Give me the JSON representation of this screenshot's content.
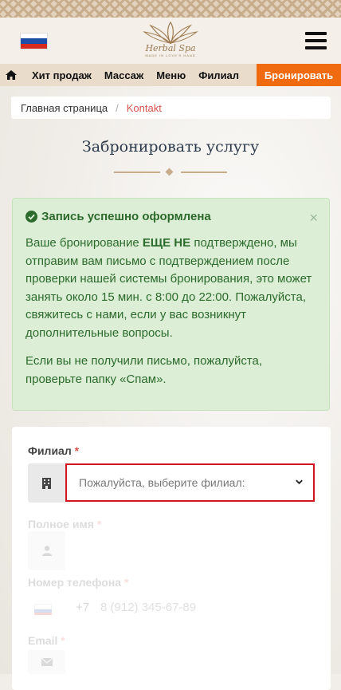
{
  "header": {
    "logo_text": "Herbal Spa",
    "logo_subtitle": "MADE IN LOVE'S HAND",
    "flag_colors": [
      "#ffffff",
      "#1f4ea8",
      "#d52b1e"
    ]
  },
  "nav": {
    "items": [
      "Хит продаж",
      "Массаж",
      "Меню",
      "Филиал"
    ],
    "book_label": "Бронировать",
    "accent_color": "#f06a0f"
  },
  "breadcrumb": {
    "home": "Главная страница",
    "separator": "/",
    "current": "Kontakt"
  },
  "page": {
    "title": "Забронировать услугу"
  },
  "alert": {
    "heading": "Запись успешно оформлена",
    "close": "×",
    "p1_start": "Ваше бронирование ",
    "p1_bold": "ЕЩЕ НЕ",
    "p1_rest": " подтверждено, мы отправим вам письмо с подтверждением после проверки нашей системы бронирования, это может занять около 15 мин. с 8:00 до 22:00. Пожалуйста, свяжитесь с нами, если у вас возникнут дополнительные вопросы.",
    "p2": "Если вы не получили письмо, пожалуйста, проверьте папку «Спам»."
  },
  "form": {
    "branch_label": "Филиал",
    "required_mark": "*",
    "branch_placeholder": "Пожалуйста, выберите филиал:",
    "name_label": "Полное имя",
    "phone_label": "Номер телефона",
    "phone_code": "+7",
    "phone_placeholder": "8 (912) 345-67-89",
    "email_label": "Email"
  }
}
